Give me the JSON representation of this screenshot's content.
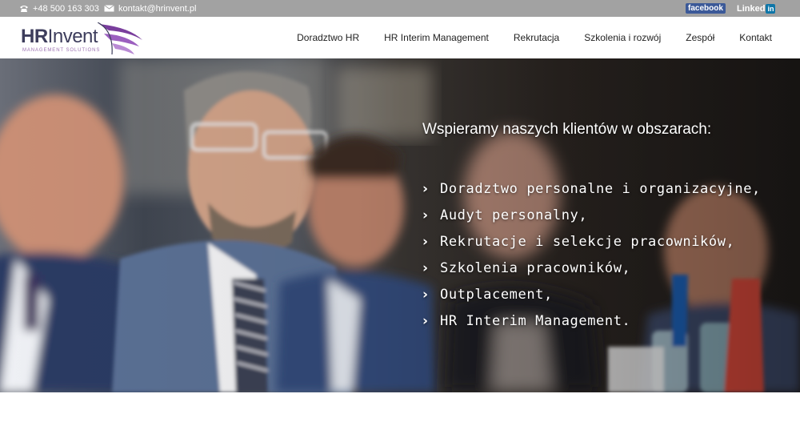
{
  "topbar": {
    "phone": "+48 500 163 303",
    "email": "kontakt@hrinvent.pl",
    "facebook_label": "facebook",
    "linkedin_label": "Linked",
    "linkedin_badge": "in"
  },
  "logo": {
    "prefix": "HR",
    "name": "Invent",
    "tagline": "MANAGEMENT SOLUTIONS"
  },
  "nav": {
    "items": [
      {
        "label": "Doradztwo HR"
      },
      {
        "label": "HR Interim Management"
      },
      {
        "label": "Rekrutacja"
      },
      {
        "label": "Szkolenia i rozwój"
      },
      {
        "label": "Zespół"
      },
      {
        "label": "Kontakt"
      }
    ]
  },
  "hero": {
    "heading": "Wspieramy naszych klientów w obszarach:",
    "services": [
      "Doradztwo personalne i organizacyjne,",
      "Audyt personalny,",
      "Rekrutacje i selekcje pracowników,",
      "Szkolenia pracowników,",
      "Outplacement,",
      "HR Interim Management."
    ],
    "arrow_glyph": "›"
  },
  "colors": {
    "topbar_bg": "#a2a2a2",
    "logo_purple": "#7a3e9d",
    "logo_dark": "#3d3d5c",
    "facebook_blue": "#3b5998",
    "linkedin_blue": "#0e76a8"
  }
}
